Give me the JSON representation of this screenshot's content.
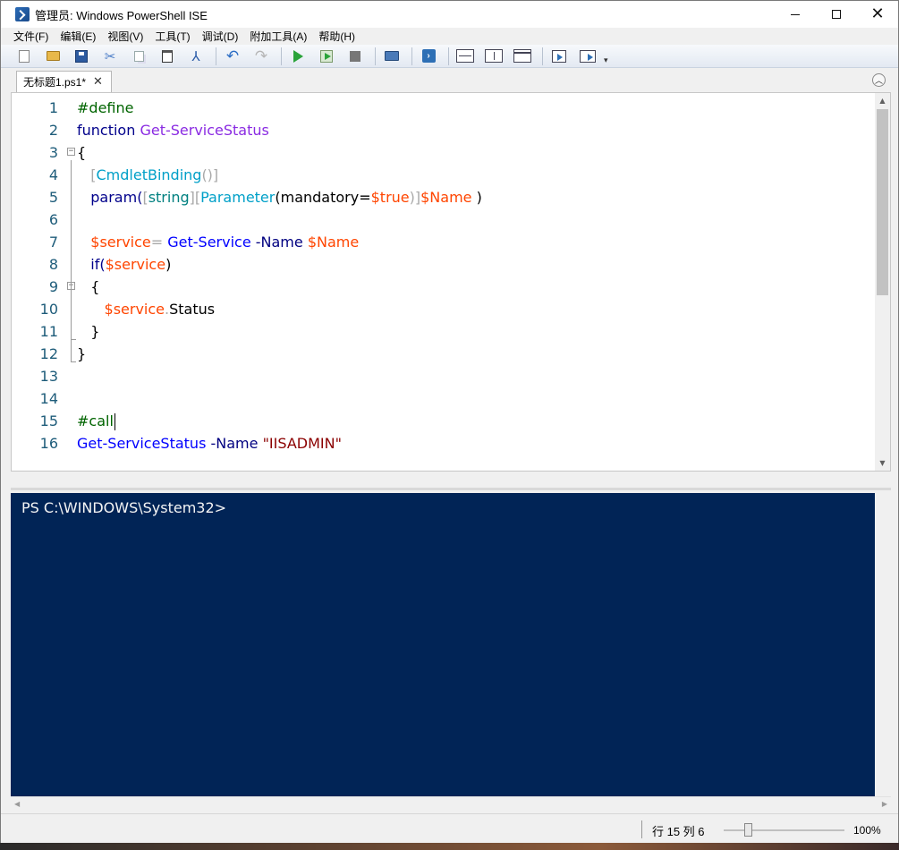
{
  "window": {
    "title": "管理员: Windows PowerShell ISE",
    "controls": {
      "minimize": "minimize",
      "maximize": "maximize",
      "close": "✕"
    }
  },
  "menubar": {
    "items": [
      "文件(F)",
      "编辑(E)",
      "视图(V)",
      "工具(T)",
      "调试(D)",
      "附加工具(A)",
      "帮助(H)"
    ]
  },
  "toolbar": {
    "icons": [
      "new-icon",
      "open-icon",
      "save-icon",
      "cut-icon",
      "copy-icon",
      "paste-icon",
      "clear-console-icon",
      "undo-icon",
      "redo-icon",
      "run-script-icon",
      "run-selection-icon",
      "stop-icon",
      "remote-powershell-icon",
      "powershell-icon",
      "layout-top-icon",
      "layout-right-icon",
      "layout-maximized-icon",
      "show-script-icon",
      "show-command-addon-icon",
      "customize-toolbar-icon"
    ]
  },
  "tabs": [
    {
      "label": "无标题1.ps1*",
      "close": "✕"
    }
  ],
  "editor": {
    "lines": [
      {
        "n": "1",
        "tokens": [
          {
            "t": "#define",
            "c": "comment"
          }
        ]
      },
      {
        "n": "2",
        "tokens": [
          {
            "t": "function ",
            "c": "kw"
          },
          {
            "t": "Get-ServiceStatus",
            "c": "func"
          }
        ]
      },
      {
        "n": "3",
        "tokens": [
          {
            "t": "{",
            "c": "plain"
          }
        ]
      },
      {
        "n": "4",
        "tokens": [
          {
            "t": "   [",
            "c": "op"
          },
          {
            "t": "CmdletBinding",
            "c": "attr"
          },
          {
            "t": "()]",
            "c": "op"
          }
        ]
      },
      {
        "n": "5",
        "tokens": [
          {
            "t": "   param(",
            "c": "kw"
          },
          {
            "t": "[",
            "c": "op"
          },
          {
            "t": "string",
            "c": "type"
          },
          {
            "t": "][",
            "c": "op"
          },
          {
            "t": "Parameter",
            "c": "attr"
          },
          {
            "t": "(mandatory=",
            "c": "plain"
          },
          {
            "t": "$true",
            "c": "var"
          },
          {
            "t": ")]",
            "c": "op"
          },
          {
            "t": "$Name",
            "c": "var"
          },
          {
            "t": " )",
            "c": "plain"
          }
        ]
      },
      {
        "n": "6",
        "tokens": []
      },
      {
        "n": "7",
        "tokens": [
          {
            "t": "   $service",
            "c": "var"
          },
          {
            "t": "= ",
            "c": "op"
          },
          {
            "t": "Get-Service",
            "c": "cmd"
          },
          {
            "t": " -Name ",
            "c": "param"
          },
          {
            "t": "$Name",
            "c": "var"
          }
        ]
      },
      {
        "n": "8",
        "tokens": [
          {
            "t": "   if(",
            "c": "kw"
          },
          {
            "t": "$service",
            "c": "var"
          },
          {
            "t": ")",
            "c": "plain"
          }
        ]
      },
      {
        "n": "9",
        "tokens": [
          {
            "t": "   {",
            "c": "plain"
          }
        ]
      },
      {
        "n": "10",
        "tokens": [
          {
            "t": "      $service",
            "c": "var"
          },
          {
            "t": ".",
            "c": "op"
          },
          {
            "t": "Status",
            "c": "plain"
          }
        ]
      },
      {
        "n": "11",
        "tokens": [
          {
            "t": "   }",
            "c": "plain"
          }
        ]
      },
      {
        "n": "12",
        "tokens": [
          {
            "t": "}",
            "c": "plain"
          }
        ]
      },
      {
        "n": "13",
        "tokens": []
      },
      {
        "n": "14",
        "tokens": []
      },
      {
        "n": "15",
        "tokens": [
          {
            "t": "#call",
            "c": "comment"
          }
        ]
      },
      {
        "n": "16",
        "tokens": [
          {
            "t": "Get-ServiceStatus",
            "c": "cmd"
          },
          {
            "t": " -Name ",
            "c": "param"
          },
          {
            "t": "\"IISADMIN\"",
            "c": "str"
          }
        ]
      }
    ],
    "caret_line": "15"
  },
  "console": {
    "prompt": "PS C:\\WINDOWS\\System32>",
    "background": "#012456"
  },
  "statusbar": {
    "position": "行 15 列 6",
    "zoom": "100%",
    "zoom_level_percent": 100
  },
  "colors": {
    "comment": "#006400",
    "keyword": "#00008b",
    "function": "#8a2be2",
    "attribute": "#00a0c8",
    "type": "#008080",
    "variable": "#ff4500",
    "command": "#0000ff",
    "string": "#8b0000"
  }
}
